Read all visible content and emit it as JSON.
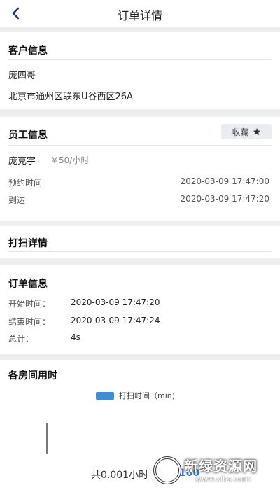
{
  "header": {
    "title": "订单详情"
  },
  "customer": {
    "title": "客户信息",
    "name": "庞四哥",
    "address": "北京市通州区联东U谷西区26A"
  },
  "staff": {
    "title": "员工信息",
    "favorite_label": "收藏",
    "name": "庞克宇",
    "rate": "￥50/小时",
    "booking_label": "预约时间",
    "booking_value": "2020-03-09 17:47:00",
    "arrive_label": "到达",
    "arrive_value": "2020-03-09 17:47:20"
  },
  "cleaning": {
    "title": "打扫详情"
  },
  "order": {
    "title": "订单信息",
    "start_label": "开始时间：",
    "start_value": "2020-03-09 17:47:20",
    "end_label": "结束时间：",
    "end_value": "2020-03-09 17:47:24",
    "total_label": "总计：",
    "total_value": "4s"
  },
  "rooms": {
    "title": "各房间用时",
    "total_text": "共0.001小时",
    "total_value": "100"
  },
  "chart_data": {
    "type": "bar",
    "legend": [
      "打扫时间（min)"
    ],
    "series": [
      {
        "name": "打扫时间（min)",
        "values": []
      }
    ],
    "colors": [
      "#3b8fd9"
    ]
  },
  "watermark": {
    "text": "新绿资源网",
    "url": "www.xlhs.com"
  }
}
